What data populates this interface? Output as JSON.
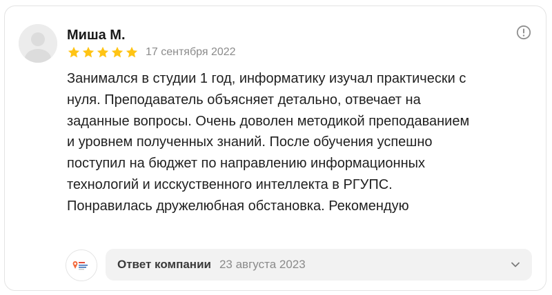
{
  "review": {
    "author": "Миша М.",
    "rating": 5,
    "rating_max": 5,
    "date": "17 сентября 2022",
    "text_lines": [
      "Занимался в студии 1 год, информатику изучал практически с",
      "нуля. Преподаватель объясняет детально, отвечает на",
      "заданные вопросы. Очень доволен методикой преподаванием",
      "и уровнем полученных знаний. После обучения успешно",
      "поступил на бюджет по направлению информационных",
      "технологий и исскуственного интеллекта в РГУПС.",
      "Понравилась дружелюбная обстановка. Рекомендую"
    ]
  },
  "reply": {
    "label": "Ответ компании",
    "date": "23 августа 2023"
  },
  "icons": {
    "star": "star-icon",
    "more": "exclamation-circle-icon",
    "expand": "chevron-down-icon",
    "avatar": "user-placeholder-icon",
    "company": "company-logo-icon"
  },
  "colors": {
    "star": "#ffc414",
    "text": "#1f1f1f",
    "muted": "#8a8a8a",
    "reply_bg": "#f2f2f2"
  }
}
